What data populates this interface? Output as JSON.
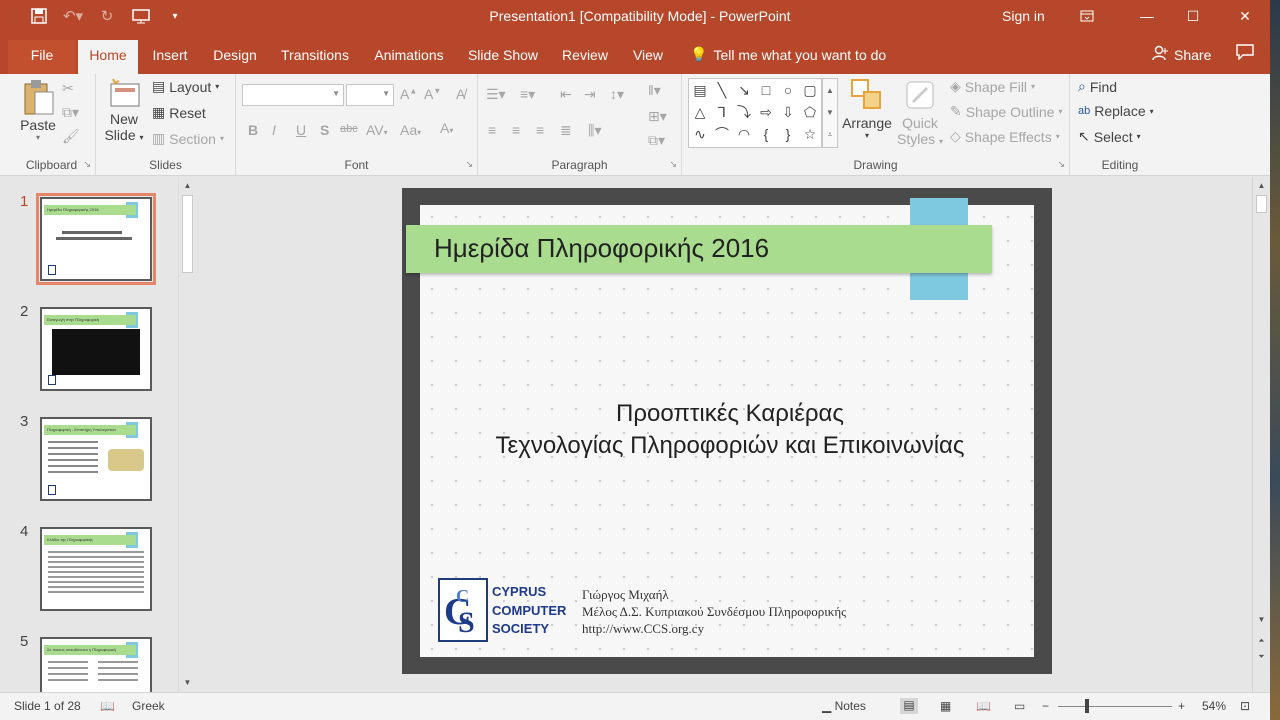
{
  "window": {
    "title": "Presentation1 [Compatibility Mode]  -  PowerPoint",
    "signin": "Sign in"
  },
  "tabs": [
    "File",
    "Home",
    "Insert",
    "Design",
    "Transitions",
    "Animations",
    "Slide Show",
    "Review",
    "View"
  ],
  "active_tab": "Home",
  "tellme": "Tell me what you want to do",
  "share": "Share",
  "ribbon": {
    "clipboard": {
      "label": "Clipboard",
      "paste": "Paste"
    },
    "slides": {
      "label": "Slides",
      "new_slide_1": "New",
      "new_slide_2": "Slide",
      "layout": "Layout",
      "reset": "Reset",
      "section": "Section"
    },
    "font": {
      "label": "Font"
    },
    "paragraph": {
      "label": "Paragraph"
    },
    "drawing": {
      "label": "Drawing",
      "arrange": "Arrange",
      "quick_styles_1": "Quick",
      "quick_styles_2": "Styles",
      "shape_fill": "Shape Fill",
      "shape_outline": "Shape Outline",
      "shape_effects": "Shape Effects"
    },
    "editing": {
      "label": "Editing",
      "find": "Find",
      "replace": "Replace",
      "select": "Select"
    }
  },
  "thumbnails": [
    {
      "num": "1",
      "title": "Ημερίδα Πληροφορικής 2016",
      "active": true
    },
    {
      "num": "2",
      "title": "Εισαγωγή στην Πληροφορική"
    },
    {
      "num": "3",
      "title": "Πληροφορική - Επιστήμη Υπολογιστών"
    },
    {
      "num": "4",
      "title": "Κλάδοι της Πληροφορικής"
    },
    {
      "num": "5",
      "title": "Σε ποιους απευθύνεται η Πληροφορική"
    }
  ],
  "slide": {
    "title": "Ημερίδα Πληροφορικής 2016",
    "subtitle_line1": "Προοπτικές Καριέρας",
    "subtitle_line2": "Τεχνολογίας Πληροφοριών και Επικοινωνίας",
    "logo_line1": "CYPRUS",
    "logo_line2": "COMPUTER",
    "logo_line3": "SOCIETY",
    "sig_name": "Γιώργος Μιχαήλ",
    "sig_role": "Μέλος Δ.Σ. Κυπριακού Συνδέσμου Πληροφορικής",
    "sig_url": "http://www.CCS.org.cy"
  },
  "status": {
    "slide_of": "Slide 1 of 28",
    "language": "Greek",
    "notes": "Notes",
    "zoom": "54%"
  },
  "colors": {
    "accent": "#b7472a",
    "band": "#a9dc8e",
    "tab": "#7ec8e0"
  }
}
